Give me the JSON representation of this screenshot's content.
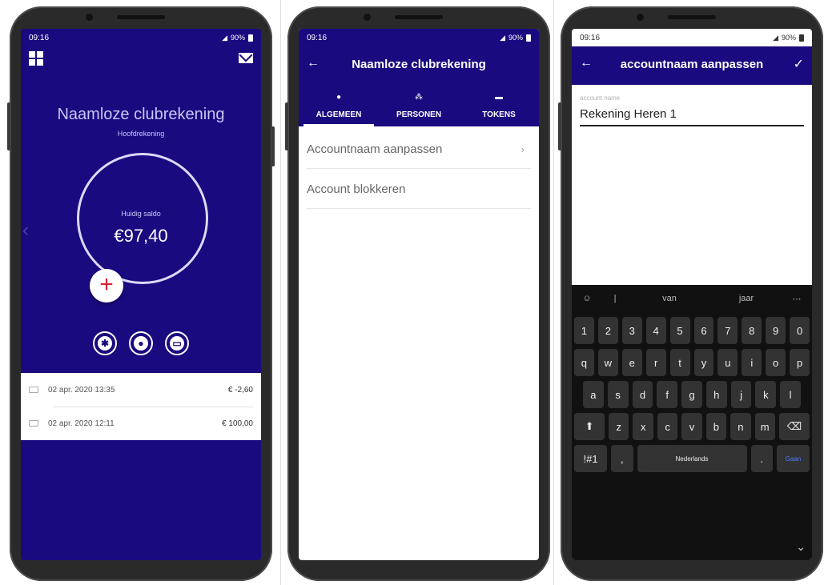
{
  "status_bar": {
    "time": "09:16",
    "battery": "90%"
  },
  "screen1": {
    "account_name": "Naamloze clubrekening",
    "account_type": "Hoofdrekening",
    "balance_label": "Huidig saldo",
    "balance": "€97,40",
    "add_symbol": "+",
    "transactions": [
      {
        "date": "02 apr. 2020  13:35",
        "amount": "€ -2,60"
      },
      {
        "date": "02 apr. 2020  12:11",
        "amount": "€ 100,00"
      }
    ]
  },
  "screen2": {
    "title": "Naamloze clubrekening",
    "tabs": [
      {
        "label": "ALGEMEEN",
        "icon": "gear-icon"
      },
      {
        "label": "PERSONEN",
        "icon": "people-icon"
      },
      {
        "label": "TOKENS",
        "icon": "card-icon"
      }
    ],
    "menu": [
      "Accountnaam aanpassen",
      "Account blokkeren"
    ]
  },
  "screen3": {
    "title": "accountnaam aanpassen",
    "field_label": "account name",
    "field_value": "Rekening Heren 1",
    "suggestions": [
      "van",
      "jaar"
    ],
    "keyboard": {
      "row_numbers": [
        "1",
        "2",
        "3",
        "4",
        "5",
        "6",
        "7",
        "8",
        "9",
        "0"
      ],
      "row1": [
        "q",
        "w",
        "e",
        "r",
        "t",
        "y",
        "u",
        "i",
        "o",
        "p"
      ],
      "row2": [
        "a",
        "s",
        "d",
        "f",
        "g",
        "h",
        "j",
        "k",
        "l"
      ],
      "row3": [
        "z",
        "x",
        "c",
        "v",
        "b",
        "n",
        "m"
      ],
      "symbols_key": "!#1",
      "comma": ",",
      "space_label": "Nederlands",
      "period": ".",
      "go_label": "Gaan"
    }
  }
}
